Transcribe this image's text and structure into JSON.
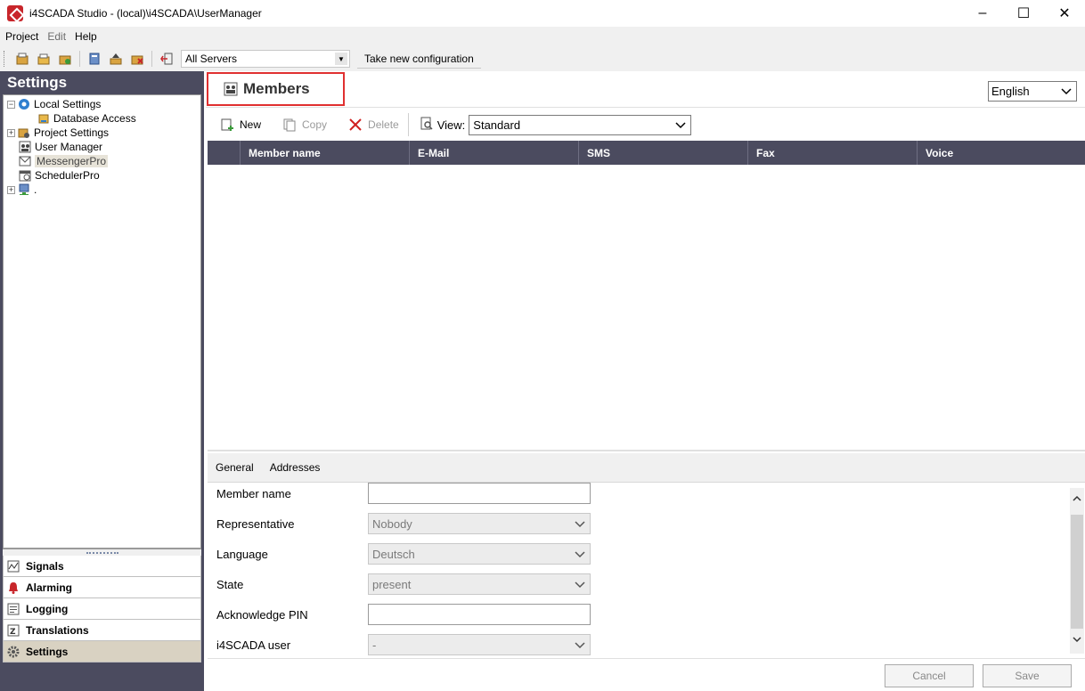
{
  "window": {
    "title": "i4SCADA Studio - (local)\\i4SCADA\\UserManager",
    "controls": [
      "–",
      "☐",
      "✕"
    ]
  },
  "menu": {
    "items": [
      {
        "label": "Project",
        "enabled": true
      },
      {
        "label": "Edit",
        "enabled": false
      },
      {
        "label": "Help",
        "enabled": true
      }
    ]
  },
  "toolbar": {
    "server_selector": "All Servers",
    "take_config_label": "Take new configuration"
  },
  "sidebar": {
    "header": "Settings",
    "tree": [
      {
        "label": "Local Settings",
        "level": 0,
        "expander": "−"
      },
      {
        "label": "Database Access",
        "level": 1,
        "expander": ""
      },
      {
        "label": "Project Settings",
        "level": 0,
        "expander": "+"
      },
      {
        "label": "User Manager",
        "level": 0,
        "expander": ""
      },
      {
        "label": "MessengerPro",
        "level": 0,
        "expander": "",
        "selected": true
      },
      {
        "label": "SchedulerPro",
        "level": 0,
        "expander": ""
      },
      {
        "label": ".",
        "level": 0,
        "expander": "+"
      }
    ],
    "nav": [
      {
        "label": "Signals",
        "icon": "signals-icon"
      },
      {
        "label": "Alarming",
        "icon": "bell-icon"
      },
      {
        "label": "Logging",
        "icon": "logging-icon"
      },
      {
        "label": "Translations",
        "icon": "translations-icon"
      },
      {
        "label": "Settings",
        "icon": "gear-icon",
        "active": true
      }
    ]
  },
  "main": {
    "title": "Members",
    "language": "English",
    "commands": {
      "new": "New",
      "copy": "Copy",
      "delete": "Delete"
    },
    "view_label": "View:",
    "view_value": "Standard",
    "columns": [
      "Member name",
      "E-Mail",
      "SMS",
      "Fax",
      "Voice"
    ]
  },
  "detail": {
    "tabs": [
      "General",
      "Addresses"
    ],
    "fields": [
      {
        "label": "Member name",
        "type": "text",
        "value": ""
      },
      {
        "label": "Representative",
        "type": "select",
        "value": "Nobody"
      },
      {
        "label": "Language",
        "type": "select",
        "value": "Deutsch"
      },
      {
        "label": "State",
        "type": "select",
        "value": "present"
      },
      {
        "label": "Acknowledge PIN",
        "type": "text",
        "value": ""
      },
      {
        "label": "i4SCADA user",
        "type": "select",
        "value": "-"
      }
    ],
    "cancel_label": "Cancel",
    "save_label": "Save"
  },
  "colors": {
    "header_dark": "#4b4b5f",
    "highlight_red": "#e03030",
    "selected_bg": "#d9d2c2"
  }
}
